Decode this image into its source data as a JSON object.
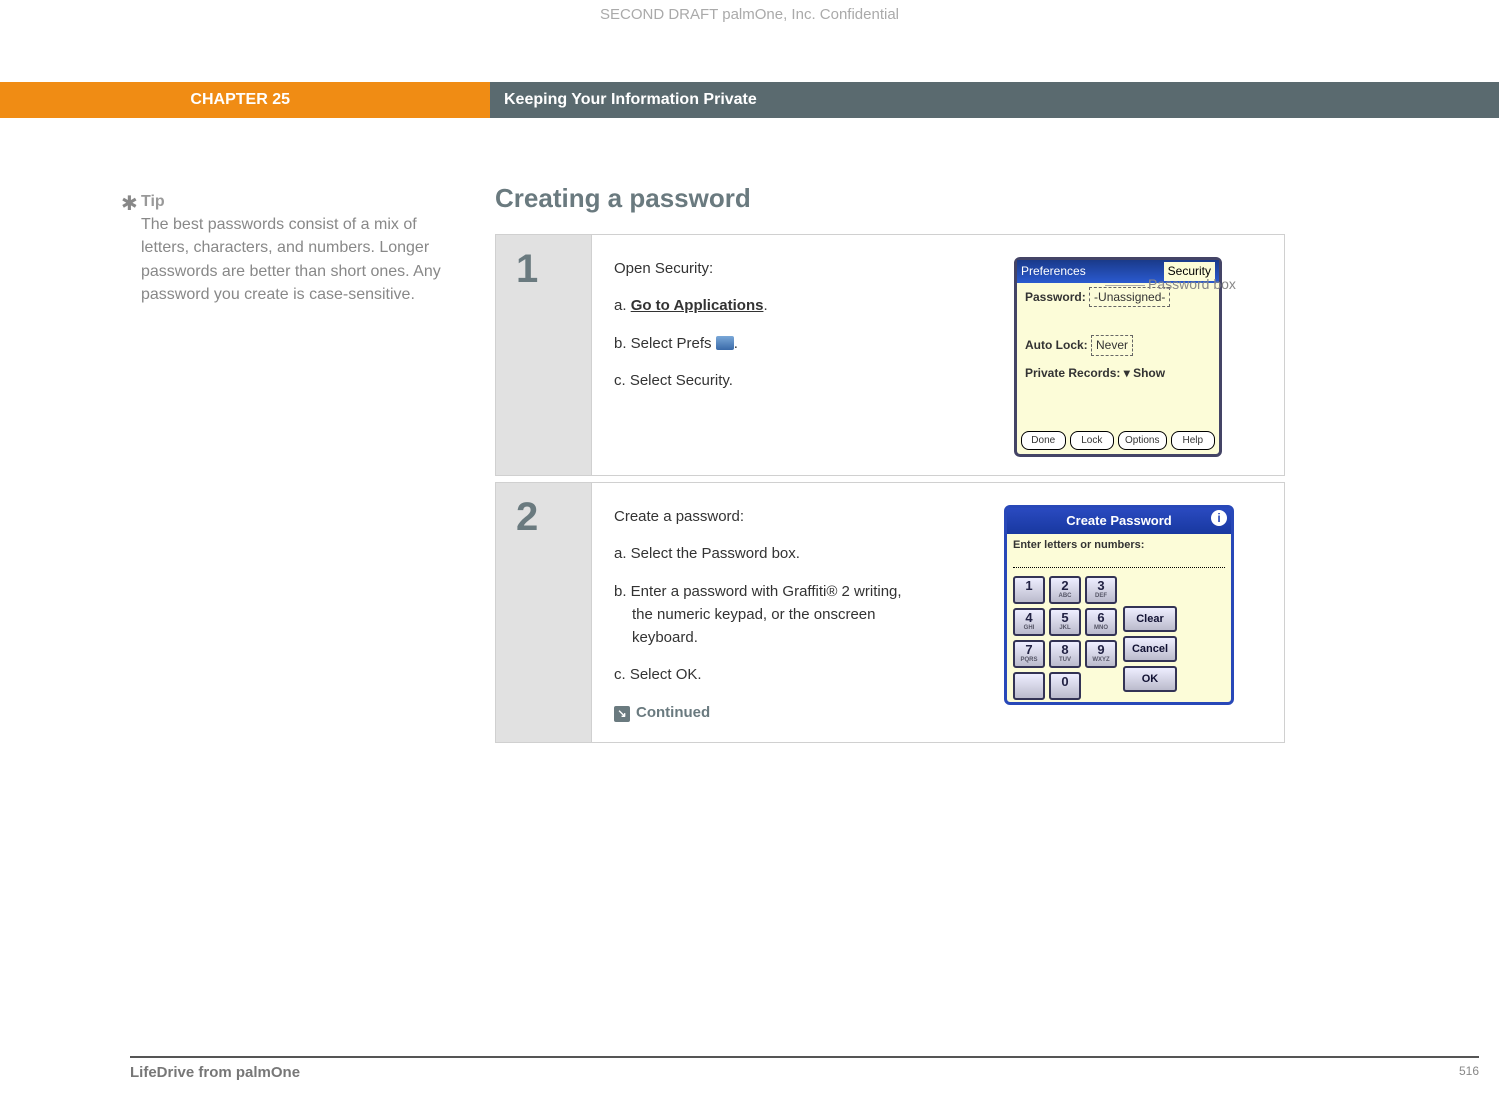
{
  "confidential": "SECOND DRAFT palmOne, Inc.  Confidential",
  "header": {
    "chapter": "CHAPTER 25",
    "section": "Keeping Your Information Private"
  },
  "tip": {
    "label": "Tip",
    "body": "The best passwords consist of a mix of letters, characters, and numbers. Longer passwords are better than short ones. Any password you create is case-sensitive."
  },
  "main": {
    "heading": "Creating a password",
    "steps": [
      {
        "num": "1",
        "intro": "Open Security:",
        "items": {
          "a_prefix": "a.  ",
          "a_link": "Go to Applications",
          "a_suffix": ".",
          "b_prefix": "b.  Select Prefs ",
          "b_suffix": ".",
          "c": "c.  Select Security."
        }
      },
      {
        "num": "2",
        "intro": "Create a password:",
        "items": {
          "a": "a.  Select the Password box.",
          "b": "b.  Enter a password with Graffiti® 2 writing, the numeric keypad, or the onscreen keyboard.",
          "c": "c.  Select OK."
        },
        "continued": "Continued"
      }
    ]
  },
  "callout": "Password box",
  "device1": {
    "title_left": "Preferences",
    "title_right": "Security",
    "password_label": "Password:",
    "password_value": "-Unassigned-",
    "autolock_label": "Auto Lock:",
    "autolock_value": "Never",
    "private_label": "Private Records:",
    "private_value": "Show",
    "buttons": {
      "done": "Done",
      "lock": "Lock",
      "options": "Options",
      "help": "Help"
    }
  },
  "device2": {
    "title": "Create Password",
    "prompt": "Enter letters or numbers:",
    "keys": [
      {
        "n": "1",
        "s": ""
      },
      {
        "n": "2",
        "s": "ABC"
      },
      {
        "n": "3",
        "s": "DEF"
      },
      {
        "n": "4",
        "s": "GHI"
      },
      {
        "n": "5",
        "s": "JKL"
      },
      {
        "n": "6",
        "s": "MNO"
      },
      {
        "n": "7",
        "s": "PQRS"
      },
      {
        "n": "8",
        "s": "TUV"
      },
      {
        "n": "9",
        "s": "WXYZ"
      },
      {
        "n": "0",
        "s": ""
      }
    ],
    "side": {
      "clear": "Clear",
      "cancel": "Cancel",
      "ok": "OK"
    }
  },
  "footer": {
    "product": "LifeDrive from palmOne",
    "page": "516"
  }
}
